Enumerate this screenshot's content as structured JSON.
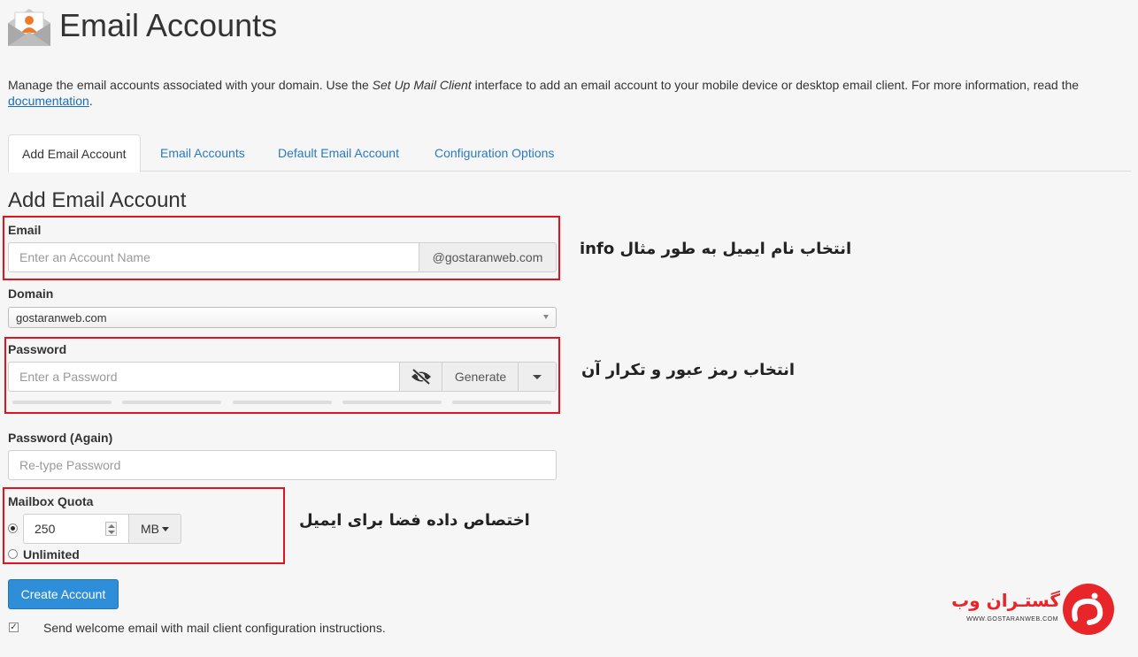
{
  "header": {
    "title": "Email Accounts",
    "icon": "envelope-user-icon"
  },
  "intro": {
    "text_before": "Manage the email accounts associated with your domain. Use the ",
    "emphasis": "Set Up Mail Client",
    "text_after": " interface to add an email account to your mobile device or desktop email client. For more information, read the ",
    "link": "documentation",
    "end": "."
  },
  "tabs": [
    {
      "label": "Add Email Account",
      "active": true
    },
    {
      "label": "Email Accounts",
      "active": false
    },
    {
      "label": "Default Email Account",
      "active": false
    },
    {
      "label": "Configuration Options",
      "active": false
    }
  ],
  "form": {
    "title": "Add Email Account",
    "email": {
      "label": "Email",
      "placeholder": "Enter an Account Name",
      "domain_suffix": "@gostaranweb.com"
    },
    "domain": {
      "label": "Domain",
      "selected": "gostaranweb.com"
    },
    "password": {
      "label": "Password",
      "placeholder": "Enter a Password",
      "generate_label": "Generate",
      "strength_segments": 5
    },
    "password_again": {
      "label": "Password (Again)",
      "placeholder": "Re-type Password"
    },
    "quota": {
      "label": "Mailbox Quota",
      "value": "250",
      "unit": "MB",
      "unlimited_label": "Unlimited",
      "selected": "limited"
    },
    "submit_label": "Create Account",
    "welcome_label": "Send welcome email with mail client configuration instructions.",
    "welcome_checked": true
  },
  "annotations": {
    "email_note": "انتخاب نام ایمیل به طور مثال info",
    "password_note": "انتخاب رمز عبور و تکرار آن",
    "quota_note": "اختصاص داده فضا برای ایمیل"
  },
  "watermark": {
    "brand": "گستـران وب",
    "url": "WWW.GOSTARANWEB.COM",
    "accent": "#e8262a"
  },
  "colors": {
    "highlight_box": "#e0141e",
    "link": "#2a7abf",
    "primary_button": "#2f8ed9"
  }
}
